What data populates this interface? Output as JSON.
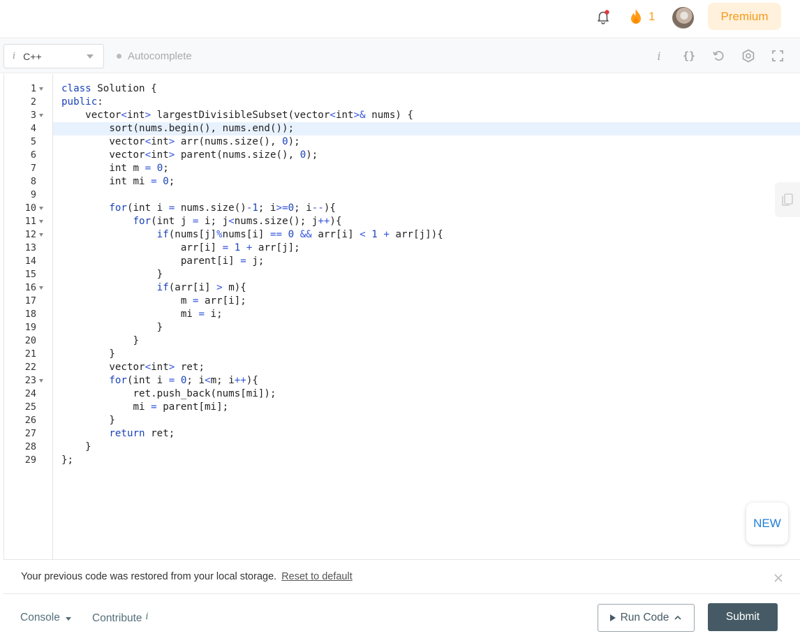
{
  "header": {
    "streak_count": "1",
    "premium_label": "Premium",
    "colors": {
      "flame": "#ff9d19",
      "premium_bg": "#fff1dc",
      "premium_text": "#f59a1c",
      "notification_dot": "#e0383e"
    }
  },
  "toolbar": {
    "language": "C++",
    "autocomplete_label": "Autocomplete",
    "icons": [
      "info-icon",
      "format-braces-icon",
      "reset-icon",
      "settings-icon",
      "fullscreen-icon"
    ]
  },
  "editor": {
    "active_line": 4,
    "lines": [
      {
        "n": "1",
        "fold": true,
        "text": "class Solution {"
      },
      {
        "n": "2",
        "fold": false,
        "text": "public:"
      },
      {
        "n": "3",
        "fold": true,
        "text": "    vector<int> largestDivisibleSubset(vector<int>& nums) {"
      },
      {
        "n": "4",
        "fold": false,
        "text": "        sort(nums.begin(), nums.end());"
      },
      {
        "n": "5",
        "fold": false,
        "text": "        vector<int> arr(nums.size(), 0);"
      },
      {
        "n": "6",
        "fold": false,
        "text": "        vector<int> parent(nums.size(), 0);"
      },
      {
        "n": "7",
        "fold": false,
        "text": "        int m = 0;"
      },
      {
        "n": "8",
        "fold": false,
        "text": "        int mi = 0;"
      },
      {
        "n": "9",
        "fold": false,
        "text": ""
      },
      {
        "n": "10",
        "fold": true,
        "text": "        for(int i = nums.size()-1; i>=0; i--){"
      },
      {
        "n": "11",
        "fold": true,
        "text": "            for(int j = i; j<nums.size(); j++){"
      },
      {
        "n": "12",
        "fold": true,
        "text": "                if(nums[j]%nums[i] == 0 && arr[i] < 1 + arr[j]){"
      },
      {
        "n": "13",
        "fold": false,
        "text": "                    arr[i] = 1 + arr[j];"
      },
      {
        "n": "14",
        "fold": false,
        "text": "                    parent[i] = j;"
      },
      {
        "n": "15",
        "fold": false,
        "text": "                }"
      },
      {
        "n": "16",
        "fold": true,
        "text": "                if(arr[i] > m){"
      },
      {
        "n": "17",
        "fold": false,
        "text": "                    m = arr[i];"
      },
      {
        "n": "18",
        "fold": false,
        "text": "                    mi = i;"
      },
      {
        "n": "19",
        "fold": false,
        "text": "                }"
      },
      {
        "n": "20",
        "fold": false,
        "text": "            }"
      },
      {
        "n": "21",
        "fold": false,
        "text": "        }"
      },
      {
        "n": "22",
        "fold": false,
        "text": "        vector<int> ret;"
      },
      {
        "n": "23",
        "fold": true,
        "text": "        for(int i = 0; i<m; i++){"
      },
      {
        "n": "24",
        "fold": false,
        "text": "            ret.push_back(nums[mi]);"
      },
      {
        "n": "25",
        "fold": false,
        "text": "            mi = parent[mi];"
      },
      {
        "n": "26",
        "fold": false,
        "text": "        }"
      },
      {
        "n": "27",
        "fold": false,
        "text": "        return ret;"
      },
      {
        "n": "28",
        "fold": false,
        "text": "    }"
      },
      {
        "n": "29",
        "fold": false,
        "text": "};"
      }
    ],
    "new_badge": "NEW",
    "colors": {
      "keyword": "#1a43b8",
      "operator": "#3355dd",
      "number": "#1a43b8",
      "active_line_bg": "#e8f2ff"
    }
  },
  "banner": {
    "message": "Your previous code was restored from your local storage.",
    "reset_link": "Reset to default"
  },
  "footer": {
    "console_label": "Console",
    "contribute_label": "Contribute",
    "run_label": "Run Code",
    "submit_label": "Submit",
    "colors": {
      "submit_bg": "#455a64"
    }
  }
}
